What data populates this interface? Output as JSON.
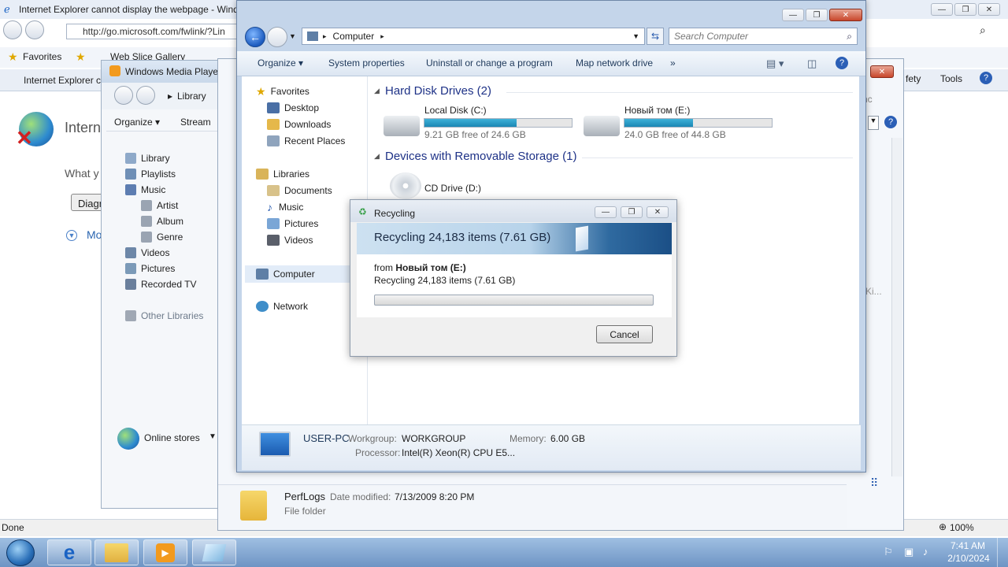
{
  "ie": {
    "title": "Internet Explorer cannot display the webpage - Windows Internet Explorer",
    "address": "http://go.microsoft.com/fwlink/?Lin",
    "favorites_label": "Favorites",
    "web_slice_label": "Web Slice Gallery",
    "tab_label": "Internet Explorer ca",
    "page_heading": "Internet",
    "page_text": "What y",
    "diagnose_label": "Diagn",
    "more_label": "Mo",
    "safety_label": "fety",
    "tools_label": "Tools",
    "status": "Done",
    "zoom": "100%"
  },
  "wmp": {
    "title": "Windows Media Playe",
    "breadcrumb": "Library",
    "organize": "Organize",
    "stream": "Stream",
    "nav": [
      {
        "label": "Library",
        "color": "#8ea9c9"
      },
      {
        "label": "Playlists",
        "color": "#6f8fb6"
      },
      {
        "label": "Music",
        "color": "#5d7db1"
      },
      {
        "label": "Artist",
        "color": "#9aa4b2"
      },
      {
        "label": "Album",
        "color": "#9aa4b2"
      },
      {
        "label": "Genre",
        "color": "#9aa4b2"
      },
      {
        "label": "Videos",
        "color": "#6d87a8"
      },
      {
        "label": "Pictures",
        "color": "#7b9ab8"
      },
      {
        "label": "Recorded TV",
        "color": "#6a7f9c"
      },
      {
        "label": "Other Libraries",
        "color": "#a0a8b4"
      }
    ],
    "online_stores": "Online stores"
  },
  "exp2": {
    "folder_name": "PerfLogs",
    "date_label": "Date modified:",
    "date_value": "7/13/2009 8:20 PM",
    "type": "File folder",
    "side_text_1": "nc",
    "side_text_2": "Ki..."
  },
  "explorer": {
    "breadcrumb": "Computer",
    "search_placeholder": "Search Computer",
    "commands": [
      "Organize",
      "System properties",
      "Uninstall or change a program",
      "Map network drive"
    ],
    "nav": {
      "favorites": "Favorites",
      "desktop": "Desktop",
      "downloads": "Downloads",
      "recent": "Recent Places",
      "libraries": "Libraries",
      "documents": "Documents",
      "music": "Music",
      "pictures": "Pictures",
      "videos": "Videos",
      "computer": "Computer",
      "network": "Network"
    },
    "groups": {
      "hdd": "Hard Disk Drives (2)",
      "removable": "Devices with Removable Storage (1)"
    },
    "drives": [
      {
        "name": "Local Disk (C:)",
        "free": "9.21 GB free of 24.6 GB",
        "used_fraction": 0.626
      },
      {
        "name": "Новый том (E:)",
        "free": "24.0 GB free of 44.8 GB",
        "used_fraction": 0.464
      }
    ],
    "cd": "CD Drive (D:)",
    "details": {
      "pc_name": "USER-PC",
      "workgroup_label": "Workgroup:",
      "workgroup": "WORKGROUP",
      "memory_label": "Memory:",
      "memory": "6.00 GB",
      "processor_label": "Processor:",
      "processor": "Intel(R) Xeon(R) CPU E5..."
    }
  },
  "dialog": {
    "title": "Recycling",
    "headline": "Recycling 24,183 items (7.61 GB)",
    "from_label": "from",
    "from_value": "Новый том (E:)",
    "status": "Recycling 24,183 items (7.61 GB)",
    "progress": 0,
    "cancel": "Cancel"
  },
  "taskbar": {
    "time": "7:41 AM",
    "date": "2/10/2024"
  },
  "colors": {
    "accent": "#1b87b4",
    "group_header": "#1e3287",
    "taskbar": "#7fa3cf"
  }
}
